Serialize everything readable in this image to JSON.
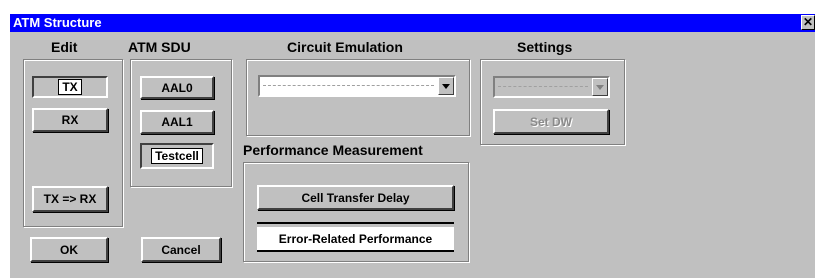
{
  "window": {
    "title": "ATM Structure",
    "close_glyph": "✕"
  },
  "edit": {
    "header": "Edit",
    "tx": "TX",
    "rx": "RX",
    "copy": "TX => RX"
  },
  "sdu": {
    "header": "ATM SDU",
    "aal0": "AAL0",
    "aal1": "AAL1",
    "testcell": "Testcell"
  },
  "circuit": {
    "header": "Circuit Emulation",
    "selected": ""
  },
  "settings": {
    "header": "Settings",
    "selected": "",
    "set_dw": "Set DW"
  },
  "performance": {
    "header": "Performance Measurement",
    "cell_delay": "Cell Transfer Delay",
    "error_related": "Error-Related Performance"
  },
  "actions": {
    "ok": "OK",
    "cancel": "Cancel"
  }
}
